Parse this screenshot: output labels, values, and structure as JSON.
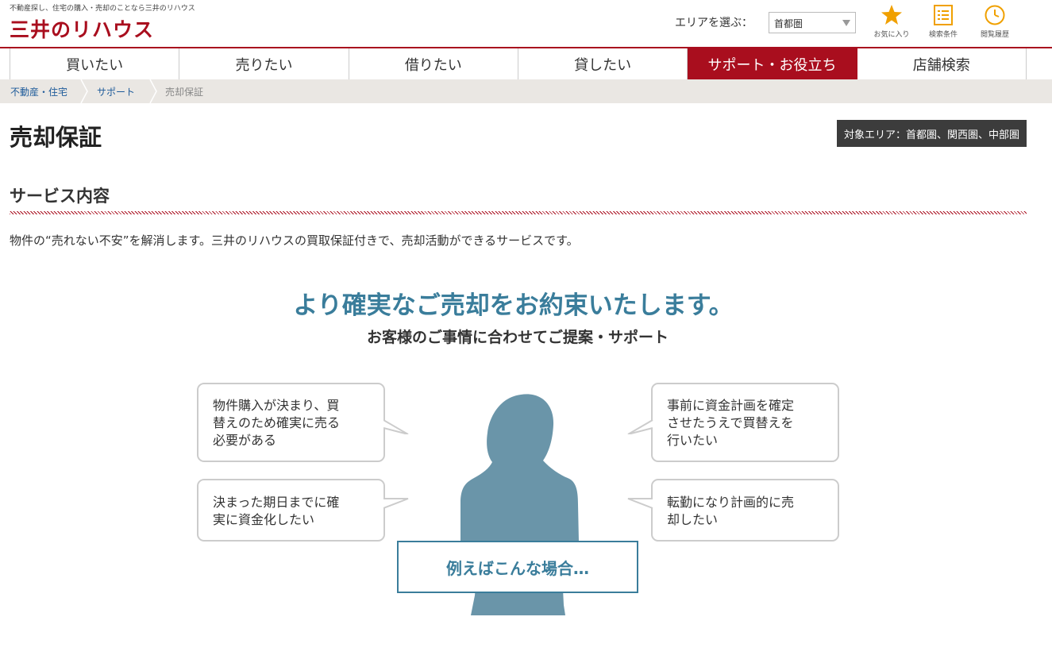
{
  "header": {
    "tagline": "不動産探し、住宅の購入・売却のことなら三井のリハウス",
    "logo": "三井のリハウス",
    "area_label": "エリアを選ぶ：",
    "area_selected": "首都圏",
    "buttons": [
      {
        "label": "お気に入り",
        "icon": "star-icon"
      },
      {
        "label": "検索条件",
        "icon": "list-icon"
      },
      {
        "label": "閲覧履歴",
        "icon": "clock-icon"
      }
    ]
  },
  "nav": {
    "items": [
      "買いたい",
      "売りたい",
      "借りたい",
      "貸したい",
      "サポート・お役立ち",
      "店舗検索"
    ],
    "active_index": 4
  },
  "breadcrumb": [
    "不動産・住宅",
    "サポート",
    "売却保証"
  ],
  "page": {
    "title": "売却保証",
    "area_badge": "対象エリア：首都圏、関西圏、中部圏",
    "section_title": "サービス内容",
    "intro": "物件の“売れない不安”を解消します。三井のリハウスの買取保証付きで、売却活動ができるサービスです。",
    "headline": "より確実なご売却をお約束いたします。",
    "subheadline": "お客様のご事情に合わせてご提案・サポート",
    "bubbles": {
      "top_left": [
        "物件購入が決まり、買",
        "替えのため確実に売る",
        "必要がある"
      ],
      "bottom_left": [
        "決まった期日までに確",
        "実に資金化したい"
      ],
      "top_right": [
        "事前に資金計画を確定",
        "させたうえで買替えを",
        "行いたい"
      ],
      "bottom_right": [
        "転勤になり計画的に売",
        "却したい"
      ]
    },
    "example_label": "例えばこんな場合…"
  },
  "colors": {
    "brand_red": "#a90e1e",
    "accent_blue": "#3a7d9b",
    "silhouette": "#6a95a9",
    "icon_orange": "#f0a000"
  }
}
